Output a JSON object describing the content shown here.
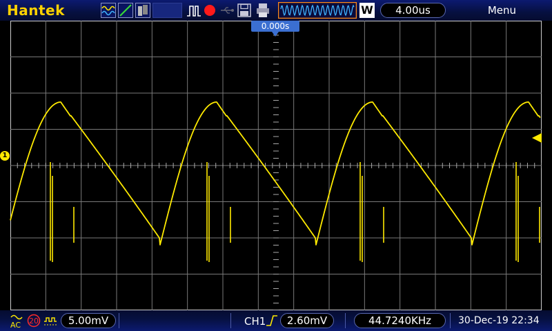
{
  "brand": "Hantek",
  "top": {
    "run_icon": "wave-mode-icon",
    "timebase": "4.00us",
    "menu_label": "Menu",
    "trigger_wave_letter": "W"
  },
  "screen": {
    "trigger_position": "0.000s",
    "ch1_marker": "1"
  },
  "bottom": {
    "coupling": "AC",
    "bw_limit": "20",
    "ch1_volts_div": "5.00mV",
    "trig_source": "CH1",
    "trig_level": "2.60mV",
    "frequency": "44.7240KHz",
    "datetime": "30-Dec-19 22:34"
  },
  "colors": {
    "trace": "#ffea00",
    "brand": "#ffd200",
    "accent": "#3b6fd1",
    "bar_bg": "#0c1a70"
  },
  "icons": [
    "wave-mode-icon",
    "line-mode-icon",
    "persist-mode-icon",
    "pulse-icon",
    "record-icon",
    "usb-icon",
    "save-icon",
    "print-icon",
    "trigger-edge-icon",
    "ac-coupling-icon",
    "bandwidth-limit-icon",
    "invert-icon"
  ]
}
